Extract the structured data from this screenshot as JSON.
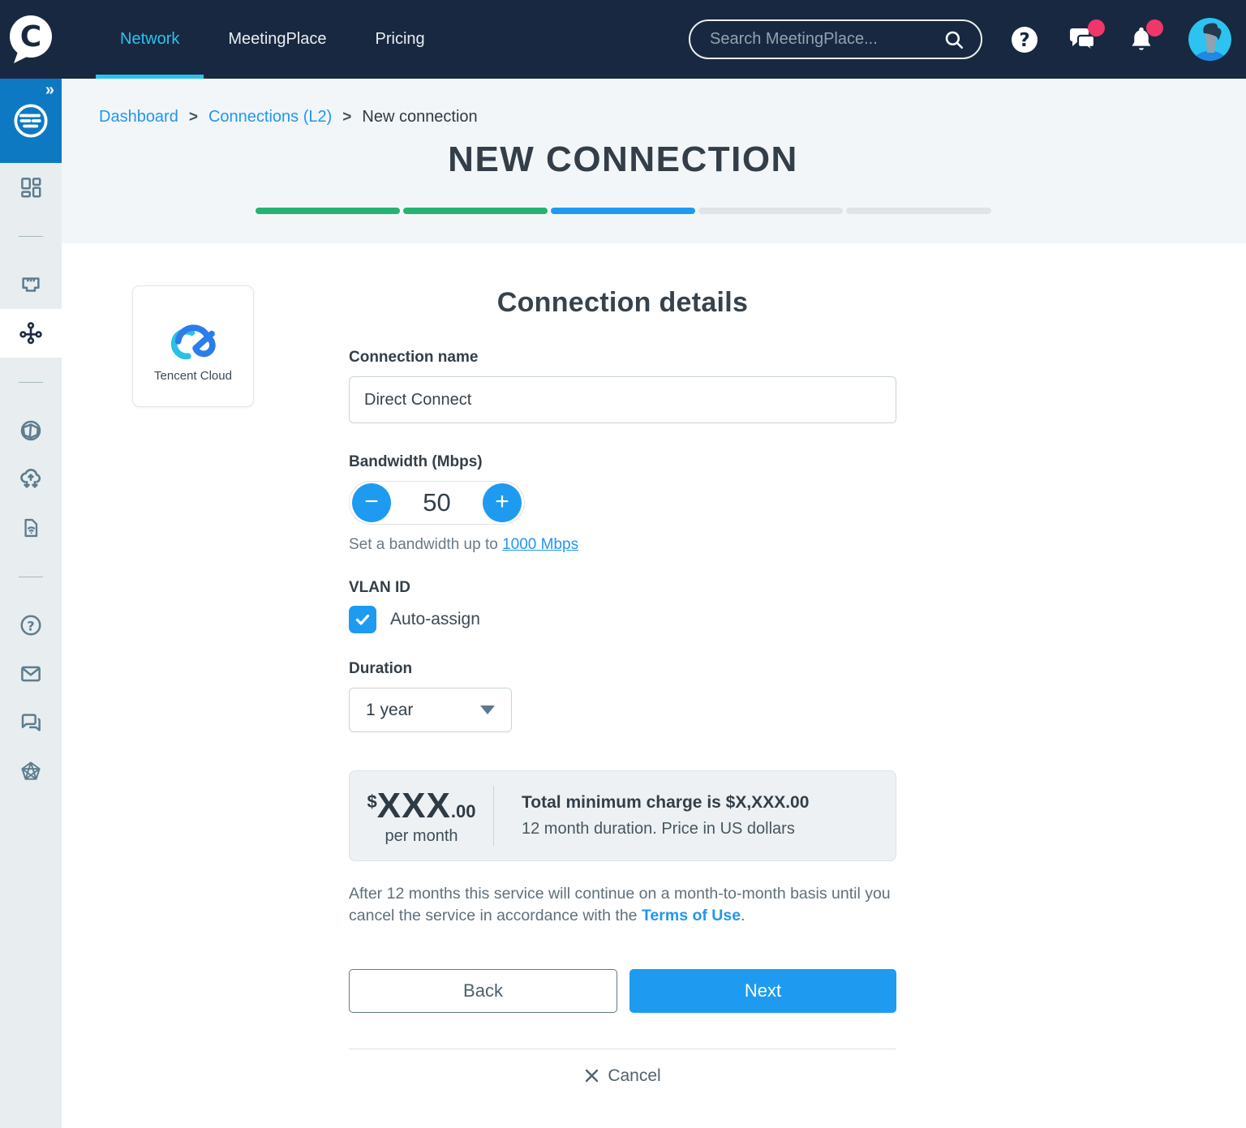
{
  "header": {
    "brand_letter": "C",
    "nav": [
      {
        "label": "Network",
        "active": true
      },
      {
        "label": "MeetingPlace",
        "active": false
      },
      {
        "label": "Pricing",
        "active": false
      }
    ],
    "search_placeholder": "Search MeetingPlace..."
  },
  "sidebar": {
    "expand_glyph": "»"
  },
  "breadcrumb": {
    "items": [
      "Dashboard",
      "Connections (L2)",
      "New connection"
    ],
    "separator": ">"
  },
  "page": {
    "title": "NEW CONNECTION"
  },
  "progress": {
    "segment_colors": [
      "#25b372",
      "#25b372",
      "#1e9bf0",
      "#dfe4e8",
      "#dfe4e8"
    ]
  },
  "provider": {
    "name": "Tencent Cloud"
  },
  "form": {
    "heading": "Connection details",
    "connection_name_label": "Connection name",
    "connection_name_value": "Direct Connect",
    "bandwidth_label": "Bandwidth (Mbps)",
    "bandwidth_value": "50",
    "bandwidth_helper": "Set a bandwidth up to ",
    "bandwidth_link": "1000 Mbps",
    "vlan_label": "VLAN ID",
    "vlan_checkbox_label": "Auto-assign",
    "duration_label": "Duration",
    "duration_value": "1 year"
  },
  "pricing": {
    "currency": "$",
    "amount": "XXX",
    "cents": ".00",
    "period": "per month",
    "total_line": "Total minimum charge is $X,XXX.00",
    "detail_line": "12 month duration. Price in US dollars"
  },
  "terms": {
    "text_before": "After 12 months this service will continue on a month-to-month basis until you cancel the service in accordance with the ",
    "link": "Terms of Use",
    "text_after": "."
  },
  "actions": {
    "back": "Back",
    "next": "Next",
    "cancel": "Cancel"
  },
  "colors": {
    "header_bg": "#182840",
    "nav_active": "#2bc3ee",
    "accent_blue": "#1e9bf0",
    "link_blue": "#2196f3",
    "badge_pink": "#f0366b",
    "progress_green": "#25b372",
    "sidebar_logo_blue": "#0e79c3"
  }
}
